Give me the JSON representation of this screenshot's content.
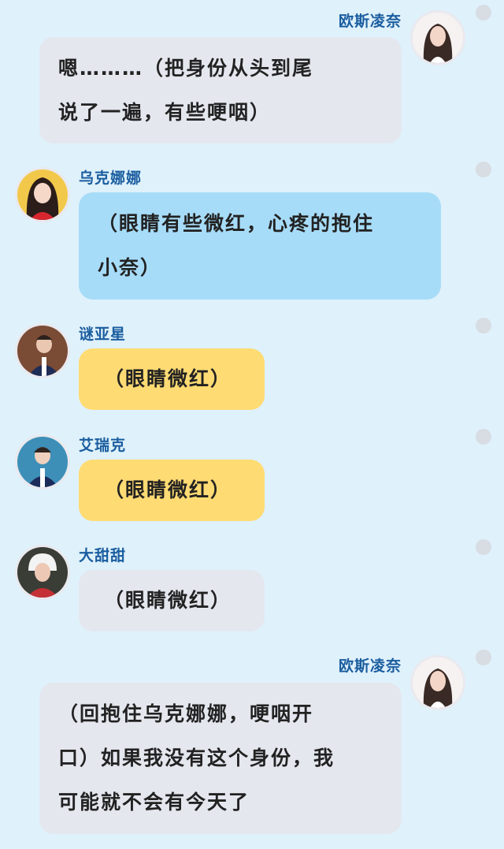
{
  "messages": [
    {
      "name": "欧斯凌奈",
      "lines": [
        "嗯………（把身份从头到尾",
        "说了一遍，有些哽咽）"
      ]
    },
    {
      "name": "乌克娜娜",
      "lines": [
        "（眼睛有些微红，心疼的抱住",
        "小奈）"
      ]
    },
    {
      "name": "谜亚星",
      "lines": [
        "（眼睛微红）"
      ]
    },
    {
      "name": "艾瑞克",
      "lines": [
        "（眼睛微红）"
      ]
    },
    {
      "name": "大甜甜",
      "lines": [
        "（眼睛微红）"
      ]
    },
    {
      "name": "欧斯凌奈",
      "lines": [
        "（回抱住乌克娜娜，哽咽开",
        "口）如果我没有这个身份，我",
        "可能就不会有今天了"
      ]
    }
  ],
  "colors": {
    "background": "#dff1fb",
    "name": "#1a5d9f",
    "bubble_gray": "#e4e7ee",
    "bubble_blue": "#a7dcf8",
    "bubble_yellow": "#ffdb73",
    "dot": "#d8dce3"
  },
  "icons": [
    "avatar-photo-icon",
    "more-dot-icon"
  ]
}
